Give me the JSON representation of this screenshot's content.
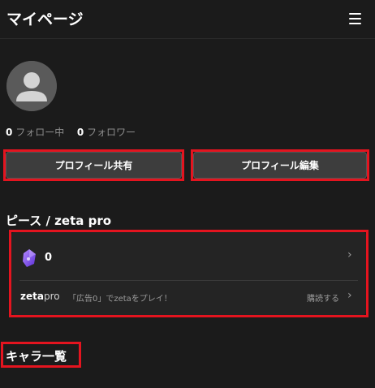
{
  "header": {
    "title": "マイページ",
    "menu_icon": "hamburger-menu-icon"
  },
  "profile": {
    "avatar_icon": "default-user-avatar-icon",
    "following_count": "0",
    "following_label": "フォロー中",
    "followers_count": "0",
    "followers_label": "フォロワー"
  },
  "actions": {
    "share_label": "プロフィール共有",
    "edit_label": "プロフィール編集"
  },
  "piece": {
    "section_title": "ピース / zeta pro",
    "gem_icon": "purple-gem-icon",
    "count": "0",
    "pro_logo_brand": "zeta",
    "pro_logo_suffix": "pro",
    "pro_text": "「広告0」でzetaをプレイ！",
    "subscribe_label": "購読する"
  },
  "characters": {
    "section_title": "キャラ一覧"
  },
  "colors": {
    "background": "#1b1b1b",
    "highlight": "#e4141f",
    "button": "#3d3d3d",
    "gem": "#7b4cf0"
  }
}
